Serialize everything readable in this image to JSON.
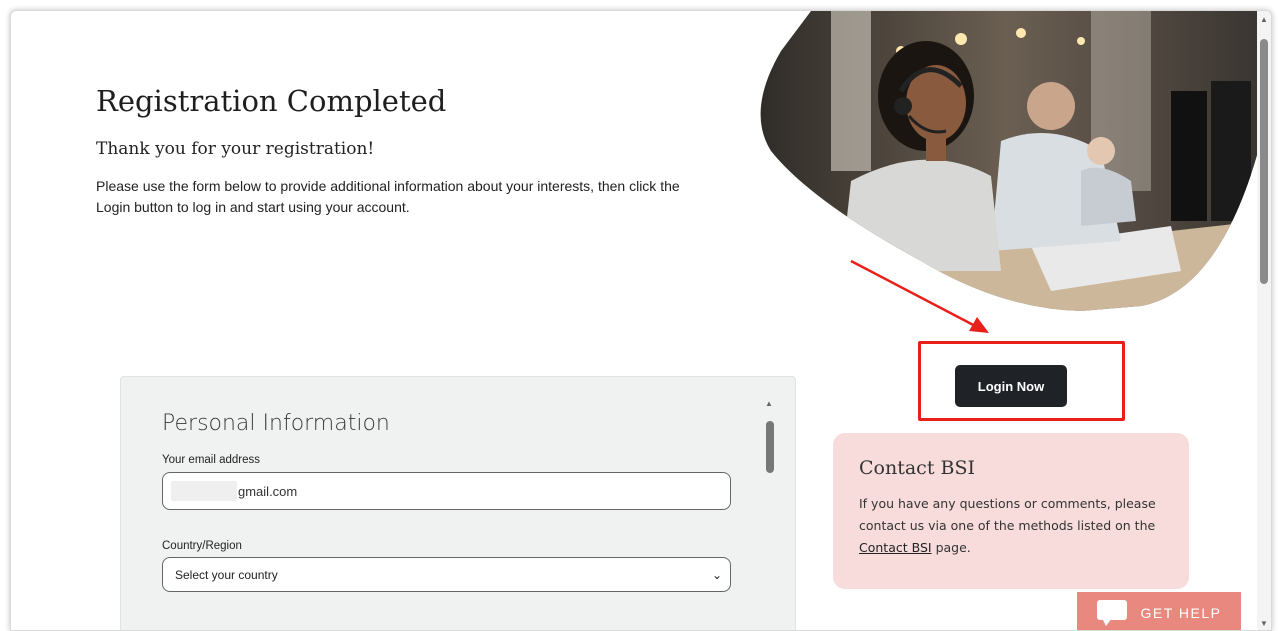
{
  "header": {
    "title": "Registration Completed",
    "subtitle": "Thank you for your registration!",
    "intro": "Please use the form below to provide additional information about your interests, then click the Login button to log in and start using your account."
  },
  "login": {
    "button_label": "Login Now"
  },
  "contact": {
    "title": "Contact BSI",
    "text_before": "If you have any questions or comments, please contact us via one of the methods listed on the ",
    "link_label": "Contact BSI",
    "text_after": " page."
  },
  "form": {
    "title": "Personal Information",
    "email_label": "Your email address",
    "email_value": "gmail.com",
    "country_label": "Country/Region",
    "country_selected": "Select your country"
  },
  "help_widget": {
    "label": "GET HELP",
    "icon": "chat-icon"
  },
  "colors": {
    "login_button": "#1f2328",
    "highlight_box": "#e8201a",
    "contact_bg": "#f8dcdc",
    "help_bg": "#e8887f",
    "form_bg": "#f0f2f2"
  }
}
